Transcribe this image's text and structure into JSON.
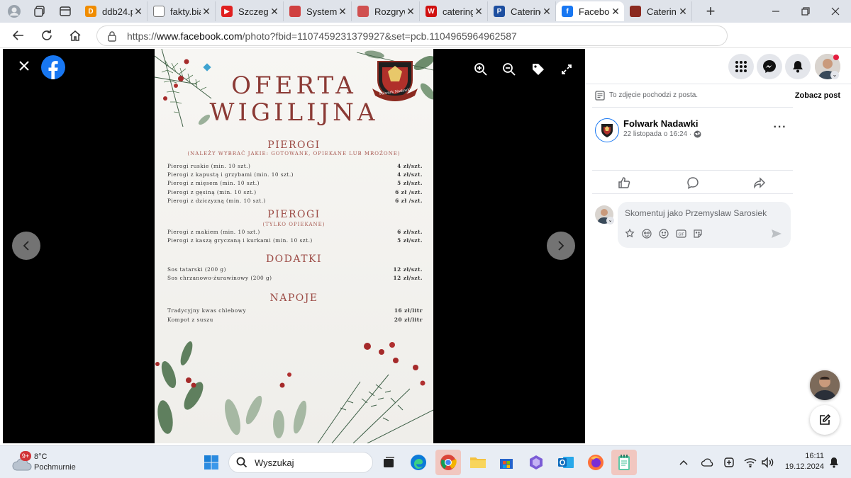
{
  "browser": {
    "tabs": [
      {
        "title": "ddb24.p",
        "favicon_color": "#f08c00",
        "favicon_letter": "D"
      },
      {
        "title": "fakty.bia",
        "favicon_color": "#ffffff",
        "favicon_letter": ""
      },
      {
        "title": "Szczegó",
        "favicon_color": "#e02020",
        "favicon_letter": "▶"
      },
      {
        "title": "System I",
        "favicon_color": "#d04040",
        "favicon_letter": ""
      },
      {
        "title": "Rozgryw",
        "favicon_color": "#d05050",
        "favicon_letter": ""
      },
      {
        "title": "catering",
        "favicon_color": "#d01010",
        "favicon_letter": "W"
      },
      {
        "title": "Catering",
        "favicon_color": "#1e4fa0",
        "favicon_letter": "P"
      },
      {
        "title": "Faceboo",
        "favicon_color": "#1877f2",
        "favicon_letter": "f",
        "active": true
      },
      {
        "title": "Caterin",
        "favicon_color": "#8b2a20",
        "favicon_letter": ""
      }
    ],
    "url_prefix": "https://",
    "url_host": "www.facebook.com",
    "url_path": "/photo?fbid=1107459231379927&set=pcb.1104965964962587"
  },
  "poster": {
    "title_line1": "OFERTA",
    "title_line2": "WIGILIJNA",
    "logo_text": "Folwark Nadawki",
    "sections": [
      {
        "heading": "PIEROGI",
        "subheading": "(NALEŻY WYBRAĆ JAKIE: GOTOWANE, OPIEKANE LUB MROŻONE)",
        "items": [
          {
            "name": "Pierogi ruskie (min. 10 szt.)",
            "price": "4 zł/szt."
          },
          {
            "name": "Pierogi z kapustą i grzybami (min. 10 szt.)",
            "price": "4 zł/szt."
          },
          {
            "name": "Pierogi z mięsem (min. 10 szt.)",
            "price": "5 zł/szt."
          },
          {
            "name": "Pierogi z gęsiną (min. 10 szt.)",
            "price": "6 zł /szt."
          },
          {
            "name": "Pierogi z dziczyzną (min. 10 szt.)",
            "price": "6 zł /szt."
          }
        ]
      },
      {
        "heading": "PIEROGI",
        "subheading": "(TYLKO OPIEKANE)",
        "items": [
          {
            "name": "Pierogi z makiem (min. 10 szt.)",
            "price": "6 zł/szt."
          },
          {
            "name": "Pierogi z kaszą gryczaną i kurkami (min. 10 szt.)",
            "price": "5 zł/szt."
          }
        ]
      },
      {
        "heading": "DODATKI",
        "subheading": "",
        "items": [
          {
            "name": "Sos tatarski (200 g)",
            "price": "12 zł/szt."
          },
          {
            "name": "Sos chrzanowo-żurawinowy (200 g)",
            "price": "12 zł/szt."
          }
        ]
      },
      {
        "heading": "NAPOJE",
        "subheading": "",
        "items": [
          {
            "name": "Tradycyjny kwas chlebowy",
            "price": "16 zł/litr"
          },
          {
            "name": "Kompot z suszu",
            "price": "20 zł/litr"
          }
        ]
      }
    ]
  },
  "panel": {
    "source_note": "To zdjęcie pochodzi z posta.",
    "view_post": "Zobacz post",
    "author": "Folwark Nadawki",
    "date": "22 listopada o 16:24 ·",
    "comment_placeholder": "Skomentuj jako Przemyslaw Sarosiek"
  },
  "taskbar": {
    "weather_temp": "8°C",
    "weather_desc": "Pochmurnie",
    "weather_badge": "9+",
    "search": "Wyszukaj",
    "time": "16:11",
    "date": "19.12.2024"
  },
  "colors": {
    "accent": "#1877f2",
    "poster_red": "#8b3a35"
  }
}
